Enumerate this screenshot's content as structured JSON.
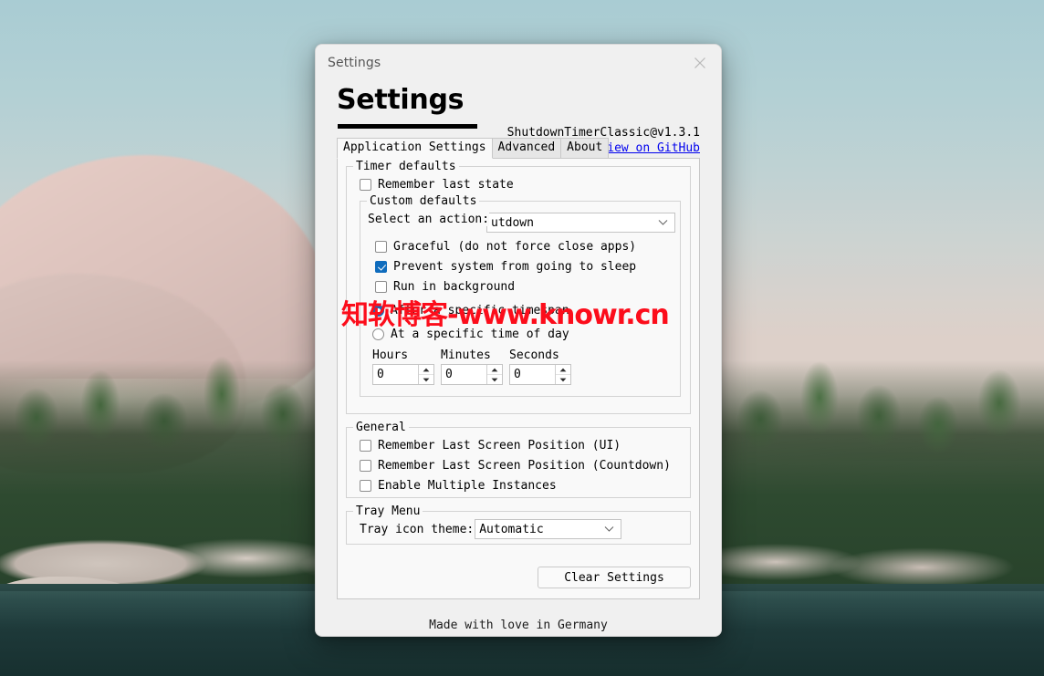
{
  "window": {
    "titlebar_label": "Settings",
    "close_icon": "close-icon",
    "page_title": "Settings",
    "version": "ShutdownTimerClassic@v1.3.1",
    "github_link": "View on GitHub",
    "footer": "Made with love in Germany"
  },
  "tabs": [
    {
      "label": "Application Settings",
      "active": true
    },
    {
      "label": "Advanced",
      "active": false
    },
    {
      "label": "About",
      "active": false
    }
  ],
  "timer_defaults": {
    "legend": "Timer defaults",
    "remember_last_state": {
      "label": "Remember last state",
      "checked": false
    }
  },
  "custom_defaults": {
    "legend": "Custom defaults",
    "action_label": "Select an action:",
    "action_value": "utdown",
    "graceful": {
      "label": "Graceful (do not force close apps)",
      "checked": false
    },
    "prevent_sleep": {
      "label": "Prevent system from going to sleep",
      "checked": true
    },
    "run_background": {
      "label": "Run in background",
      "checked": false
    },
    "mode_timespan": {
      "label": "After a specific timespan",
      "checked": true
    },
    "mode_timeofday": {
      "label": "At a specific time of day",
      "checked": false
    },
    "hours_label": "Hours",
    "minutes_label": "Minutes",
    "seconds_label": "Seconds",
    "hours_value": "0",
    "minutes_value": "0",
    "seconds_value": "0"
  },
  "general": {
    "legend": "General",
    "items": [
      {
        "label": "Remember Last Screen Position (UI)",
        "checked": false
      },
      {
        "label": "Remember Last Screen Position (Countdown)",
        "checked": false
      },
      {
        "label": "Enable Multiple Instances",
        "checked": false
      }
    ]
  },
  "tray_menu": {
    "legend": "Tray Menu",
    "theme_label": "Tray icon theme:",
    "theme_value": "Automatic"
  },
  "actions": {
    "clear_settings": "Clear Settings"
  },
  "watermark": {
    "text": "知软博客-www.knowr.cn",
    "color": "#fc0d1b"
  },
  "colors": {
    "accent": "#0f6cbd",
    "link": "#0000ee",
    "window_bg": "#f0f0f0",
    "panel_bg": "#f9f9f9"
  }
}
